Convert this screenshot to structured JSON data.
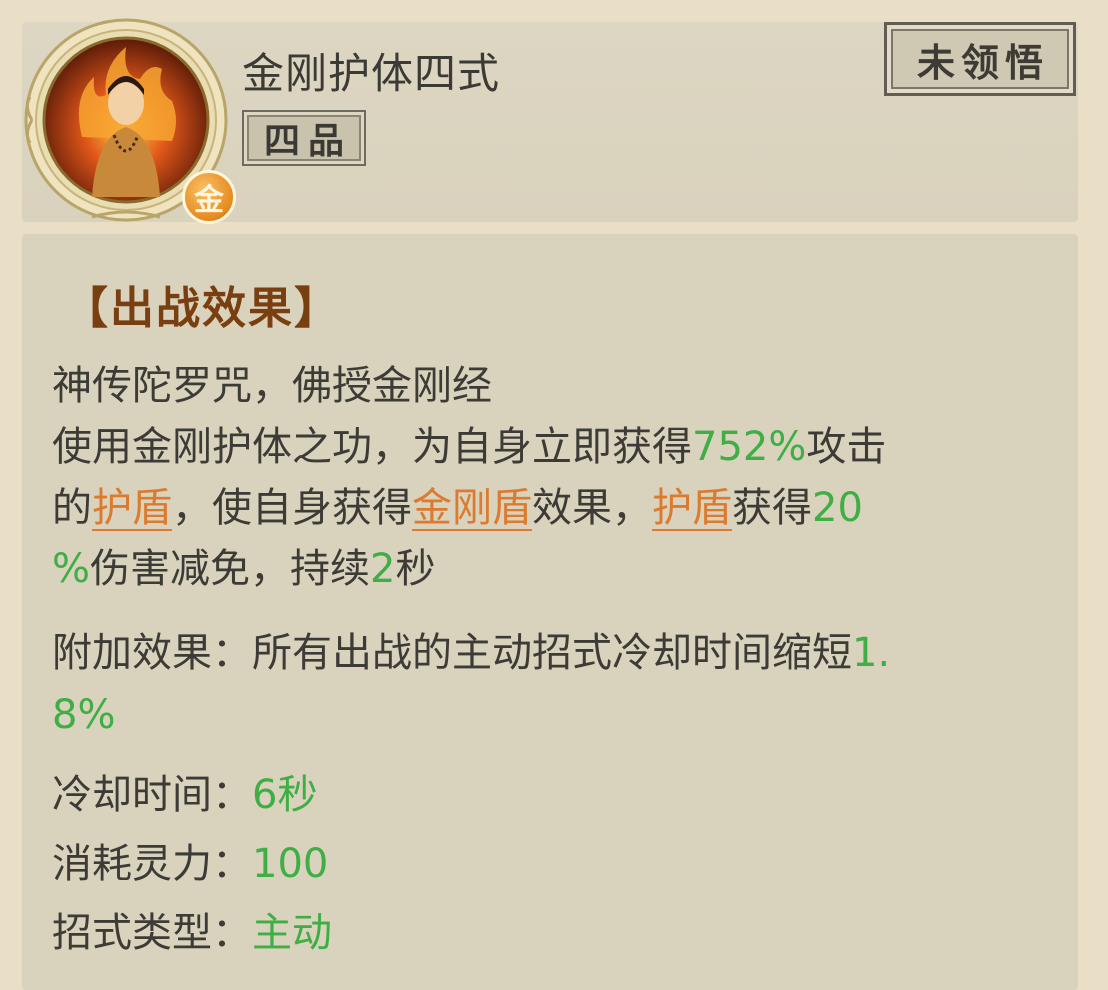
{
  "skill": {
    "name": "金刚护体四式",
    "tier": "四品",
    "status": "未领悟",
    "grade_badge": "金",
    "portrait_icon": "monk-flame-portrait-icon"
  },
  "effect": {
    "section_title": "【出战效果】",
    "line1": "神传陀罗咒，佛授金刚经",
    "line2_a": "使用金刚护体之功，为自身立即获得",
    "line2_pct": "752%",
    "line2_b": "攻击",
    "line3_a": "的",
    "line3_link1": "护盾",
    "line3_b": "，使自身获得",
    "line3_link2": "金刚盾",
    "line3_c": "效果，",
    "line3_link3": "护盾",
    "line3_d": "获得",
    "line3_pct": "20",
    "line4_pct": "%",
    "line4_a": "伤害减免，持续",
    "line4_num": "2",
    "line4_b": "秒"
  },
  "extra": {
    "label": "附加效果：所有出战的主动招式冷却时间缩短",
    "value_a": "1.",
    "value_b": "8%"
  },
  "stats": {
    "cooldown_label": "冷却时间：",
    "cooldown_value": "6秒",
    "cost_label": "消耗灵力：",
    "cost_value": "100",
    "type_label": "招式类型：",
    "type_value": "主动"
  },
  "colors": {
    "highlight_green": "#3fae45",
    "link_orange": "#dc7a2e",
    "title_brown": "#7a3f10"
  }
}
